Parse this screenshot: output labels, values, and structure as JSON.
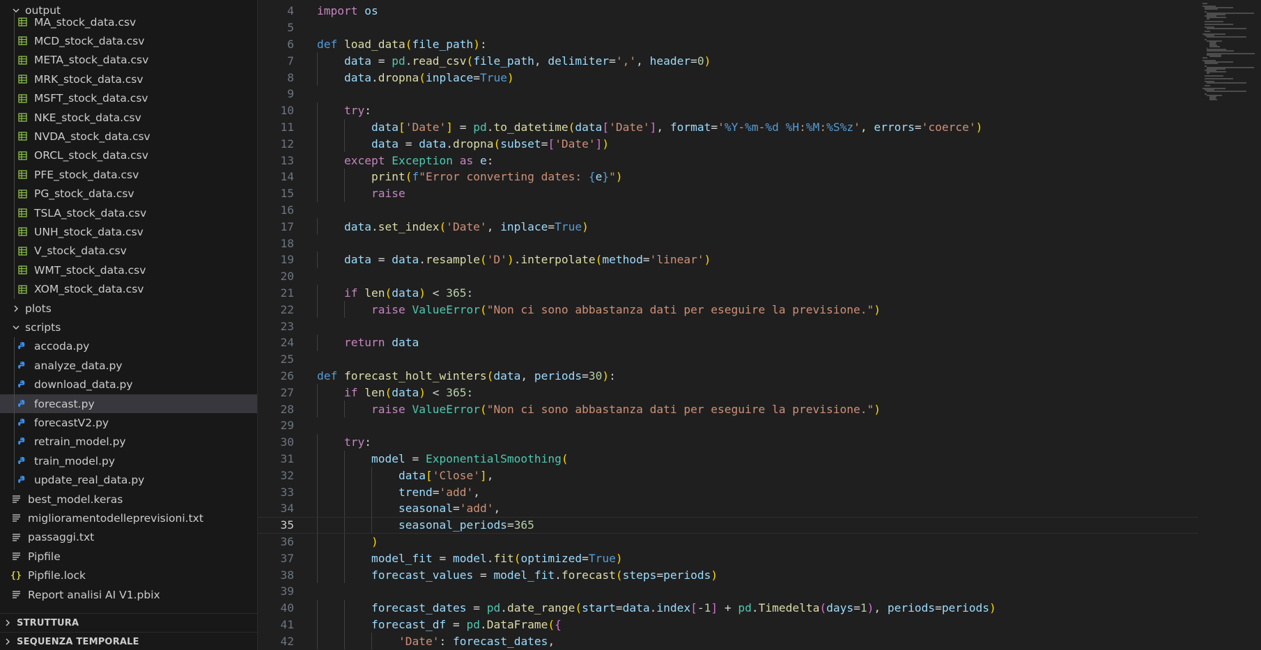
{
  "explorer": {
    "folder_output": "output",
    "output_files": [
      "MA_stock_data.csv",
      "MCD_stock_data.csv",
      "META_stock_data.csv",
      "MRK_stock_data.csv",
      "MSFT_stock_data.csv",
      "NKE_stock_data.csv",
      "NVDA_stock_data.csv",
      "ORCL_stock_data.csv",
      "PFE_stock_data.csv",
      "PG_stock_data.csv",
      "TSLA_stock_data.csv",
      "UNH_stock_data.csv",
      "V_stock_data.csv",
      "WMT_stock_data.csv",
      "XOM_stock_data.csv"
    ],
    "folder_plots": "plots",
    "folder_scripts": "scripts",
    "script_files": [
      "accoda.py",
      "analyze_data.py",
      "download_data.py",
      "forecast.py",
      "forecastV2.py",
      "retrain_model.py",
      "train_model.py",
      "update_real_data.py"
    ],
    "selected_file": "forecast.py",
    "root_files": [
      {
        "name": "best_model.keras",
        "icon": "lines-icon"
      },
      {
        "name": "miglioramentodelleprevisioni.txt",
        "icon": "lines-icon"
      },
      {
        "name": "passaggi.txt",
        "icon": "lines-icon"
      },
      {
        "name": "Pipfile",
        "icon": "lines-icon"
      },
      {
        "name": "Pipfile.lock",
        "icon": "braces-icon"
      },
      {
        "name": "Report analisi AI V1.pbix",
        "icon": "lines-icon"
      }
    ],
    "section_outline": "STRUTTURA",
    "section_timeline": "SEQUENZA TEMPORALE",
    "colors": {
      "csv_icon": "#8dc149",
      "py_icon": "#3b8eea",
      "braces_icon": "#cbcb41"
    }
  },
  "editor": {
    "current_line": 35,
    "lines": [
      {
        "n": "4",
        "code": "import os"
      },
      {
        "n": "5",
        "code": ""
      },
      {
        "n": "6",
        "code": "def load_data(file_path):"
      },
      {
        "n": "7",
        "code": "    data = pd.read_csv(file_path, delimiter=',', header=0)"
      },
      {
        "n": "8",
        "code": "    data.dropna(inplace=True)"
      },
      {
        "n": "9",
        "code": ""
      },
      {
        "n": "10",
        "code": "    try:"
      },
      {
        "n": "11",
        "code": "        data['Date'] = pd.to_datetime(data['Date'], format='%Y-%m-%d %H:%M:%S%z', errors='coerce')"
      },
      {
        "n": "12",
        "code": "        data = data.dropna(subset=['Date'])"
      },
      {
        "n": "13",
        "code": "    except Exception as e:"
      },
      {
        "n": "14",
        "code": "        print(f\"Error converting dates: {e}\")"
      },
      {
        "n": "15",
        "code": "        raise"
      },
      {
        "n": "16",
        "code": ""
      },
      {
        "n": "17",
        "code": "    data.set_index('Date', inplace=True)"
      },
      {
        "n": "18",
        "code": ""
      },
      {
        "n": "19",
        "code": "    data = data.resample('D').interpolate(method='linear')"
      },
      {
        "n": "20",
        "code": ""
      },
      {
        "n": "21",
        "code": "    if len(data) < 365:"
      },
      {
        "n": "22",
        "code": "        raise ValueError(\"Non ci sono abbastanza dati per eseguire la previsione.\")"
      },
      {
        "n": "23",
        "code": ""
      },
      {
        "n": "24",
        "code": "    return data"
      },
      {
        "n": "25",
        "code": ""
      },
      {
        "n": "26",
        "code": "def forecast_holt_winters(data, periods=30):"
      },
      {
        "n": "27",
        "code": "    if len(data) < 365:"
      },
      {
        "n": "28",
        "code": "        raise ValueError(\"Non ci sono abbastanza dati per eseguire la previsione.\")"
      },
      {
        "n": "29",
        "code": ""
      },
      {
        "n": "30",
        "code": "    try:"
      },
      {
        "n": "31",
        "code": "        model = ExponentialSmoothing("
      },
      {
        "n": "32",
        "code": "            data['Close'],"
      },
      {
        "n": "33",
        "code": "            trend='add',"
      },
      {
        "n": "34",
        "code": "            seasonal='add',"
      },
      {
        "n": "35",
        "code": "            seasonal_periods=365"
      },
      {
        "n": "36",
        "code": "        )"
      },
      {
        "n": "37",
        "code": "        model_fit = model.fit(optimized=True)"
      },
      {
        "n": "38",
        "code": "        forecast_values = model_fit.forecast(steps=periods)"
      },
      {
        "n": "39",
        "code": ""
      },
      {
        "n": "40",
        "code": "        forecast_dates = pd.date_range(start=data.index[-1] + pd.Timedelta(days=1), periods=periods)"
      },
      {
        "n": "41",
        "code": "        forecast_df = pd.DataFrame({"
      },
      {
        "n": "42",
        "code": "            'Date': forecast_dates,"
      }
    ]
  }
}
